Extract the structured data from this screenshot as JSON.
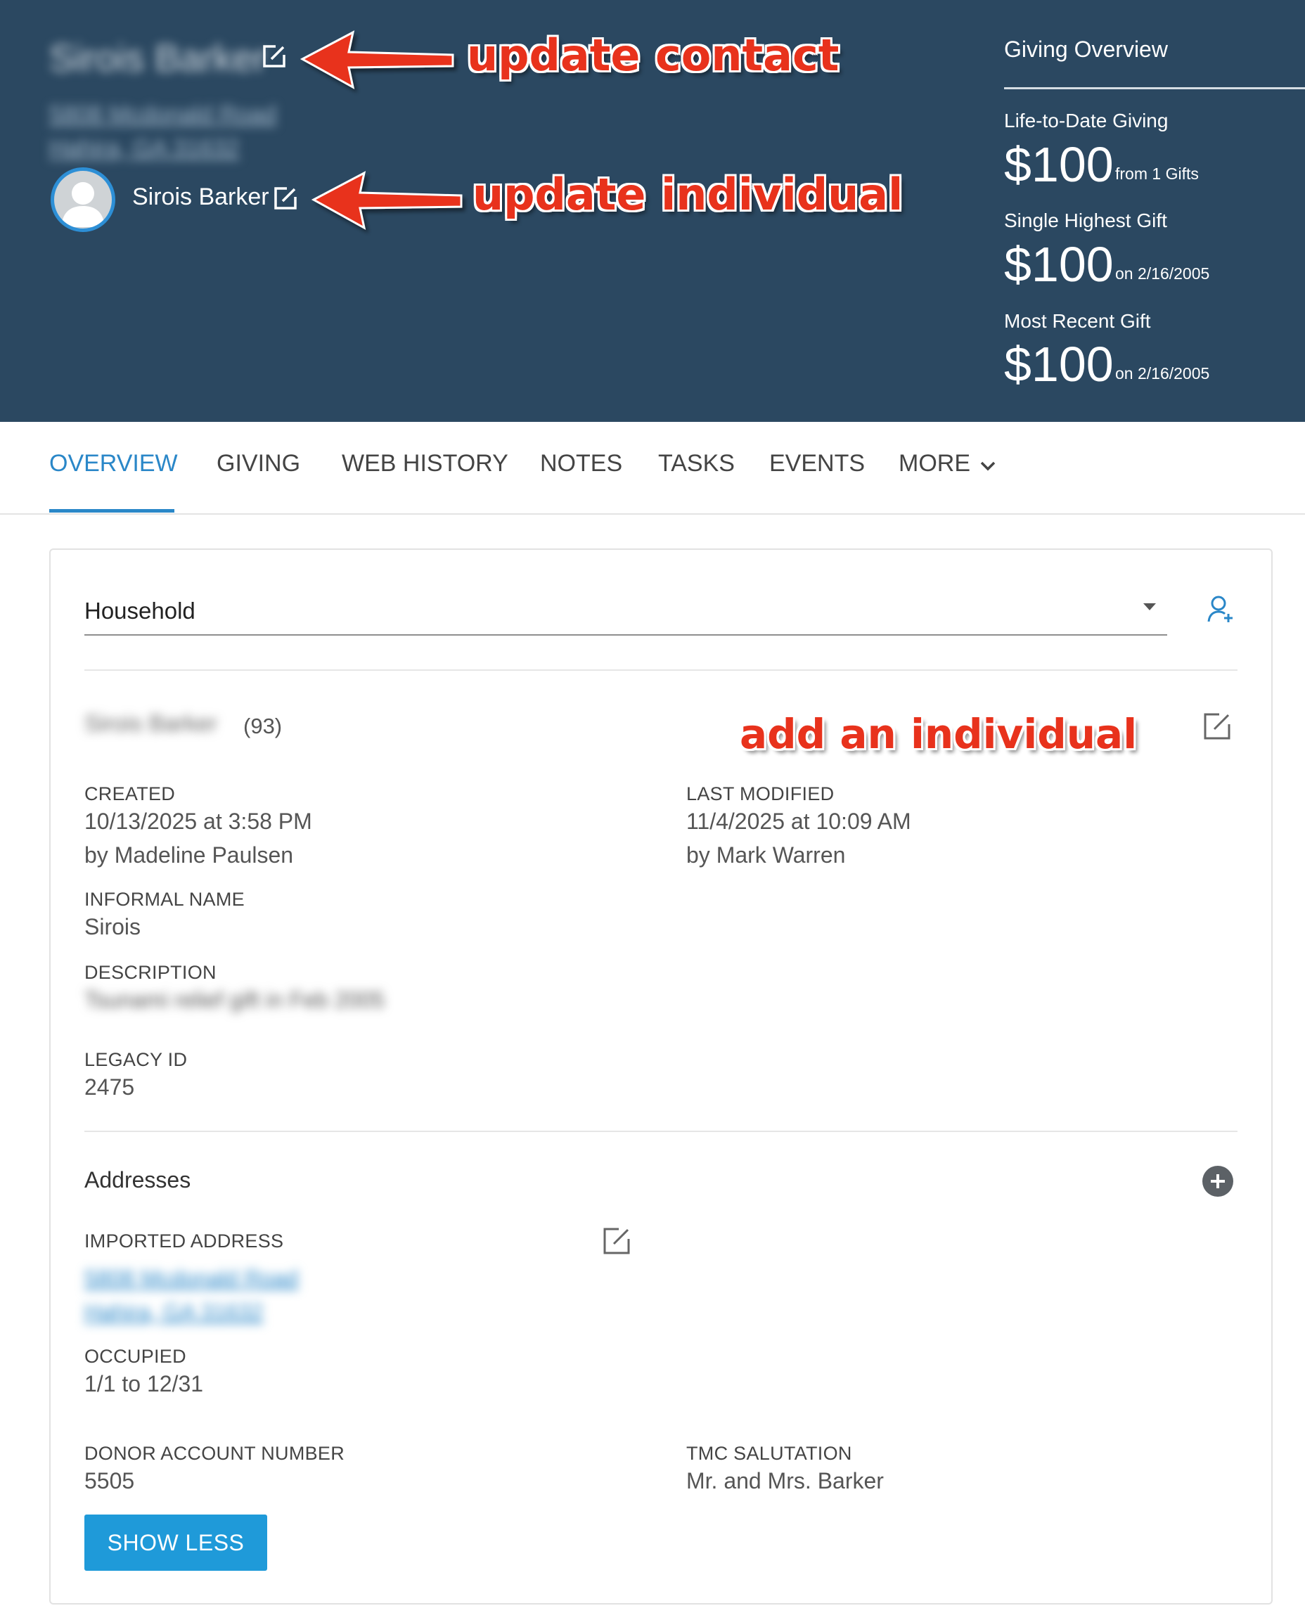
{
  "header": {
    "contact_name": "Sirois Barker",
    "contact_address_line1": "5808 Mcdonald Road",
    "contact_address_line2": "Hahira, GA 31632",
    "individual_name": "Sirois Barker"
  },
  "annotations": {
    "update_contact": "update contact",
    "update_individual": "update individual",
    "add_individual": "add an individual"
  },
  "giving_overview": {
    "title": "Giving Overview",
    "life_to_date_label": "Life-to-Date Giving",
    "life_to_date_amount": "$100",
    "life_to_date_sub": "from 1 Gifts",
    "single_highest_label": "Single Highest Gift",
    "single_highest_amount": "$100",
    "single_highest_sub": "on 2/16/2005",
    "most_recent_label": "Most Recent Gift",
    "most_recent_amount": "$100",
    "most_recent_sub": "on 2/16/2005"
  },
  "tabs": [
    {
      "label": "OVERVIEW",
      "active": true
    },
    {
      "label": "GIVING",
      "active": false
    },
    {
      "label": "WEB HISTORY",
      "active": false
    },
    {
      "label": "NOTES",
      "active": false
    },
    {
      "label": "TASKS",
      "active": false
    },
    {
      "label": "EVENTS",
      "active": false
    },
    {
      "label": "MORE",
      "active": false
    }
  ],
  "household": {
    "select_value": "Household",
    "name": "Sirois Barker",
    "count": "(93)",
    "created_label": "CREATED",
    "created_date": "10/13/2025 at 3:58 PM",
    "created_by": "by Madeline Paulsen",
    "modified_label": "LAST MODIFIED",
    "modified_date": "11/4/2025 at 10:09 AM",
    "modified_by": "by Mark Warren",
    "informal_name_label": "INFORMAL NAME",
    "informal_name": "Sirois",
    "description_label": "DESCRIPTION",
    "description": "Tsunami relief gift in Feb 2005",
    "legacy_id_label": "LEGACY ID",
    "legacy_id": "2475"
  },
  "addresses": {
    "title": "Addresses",
    "imported_label": "IMPORTED ADDRESS",
    "line1": "5808 Mcdonald Road",
    "line2": "Hahira, GA 31632",
    "occupied_label": "OCCUPIED",
    "occupied": "1/1 to 12/31"
  },
  "extra": {
    "donor_account_label": "DONOR ACCOUNT NUMBER",
    "donor_account": "5505",
    "salutation_label": "TMC SALUTATION",
    "salutation": "Mr. and Mrs. Barker",
    "show_less": "SHOW LESS"
  },
  "colors": {
    "header_bg": "#2b4861",
    "accent": "#2a87c8",
    "annotation": "#e8321c",
    "button": "#1f9ad9"
  },
  "icons": [
    "edit-icon",
    "user-avatar-icon",
    "add-person-icon",
    "plus-circle-icon",
    "chevron-down-icon",
    "caret-down-icon"
  ]
}
